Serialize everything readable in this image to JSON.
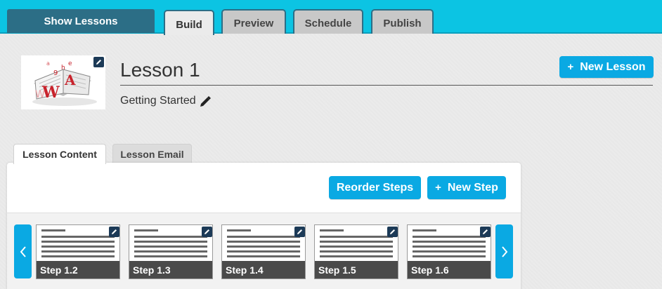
{
  "topbar": {
    "show_lessons_label": "Show Lessons",
    "tabs": [
      {
        "label": "Build",
        "active": true
      },
      {
        "label": "Preview",
        "active": false
      },
      {
        "label": "Schedule",
        "active": false
      },
      {
        "label": "Publish",
        "active": false
      }
    ]
  },
  "lesson": {
    "title": "Lesson 1",
    "subtitle": "Getting Started",
    "new_lesson_label": "New Lesson"
  },
  "content_tabs": [
    {
      "label": "Lesson Content",
      "active": true
    },
    {
      "label": "Lesson Email",
      "active": false
    }
  ],
  "actions": {
    "reorder_label": "Reorder Steps",
    "new_step_label": "New Step",
    "plus_glyph": "+"
  },
  "steps": [
    {
      "label": "Step 1.2"
    },
    {
      "label": "Step 1.3"
    },
    {
      "label": "Step 1.4"
    },
    {
      "label": "Step 1.5"
    },
    {
      "label": "Step 1.6"
    }
  ],
  "colors": {
    "topbar": "#0cc4e3",
    "accent_button": "#0aa9e3",
    "show_lessons_bg": "#2c6e86",
    "edit_badge": "#1c3a57"
  },
  "icons": [
    "edit-icon",
    "pencil-icon",
    "chevron-left-icon",
    "chevron-right-icon",
    "plus-icon",
    "book-logo"
  ]
}
